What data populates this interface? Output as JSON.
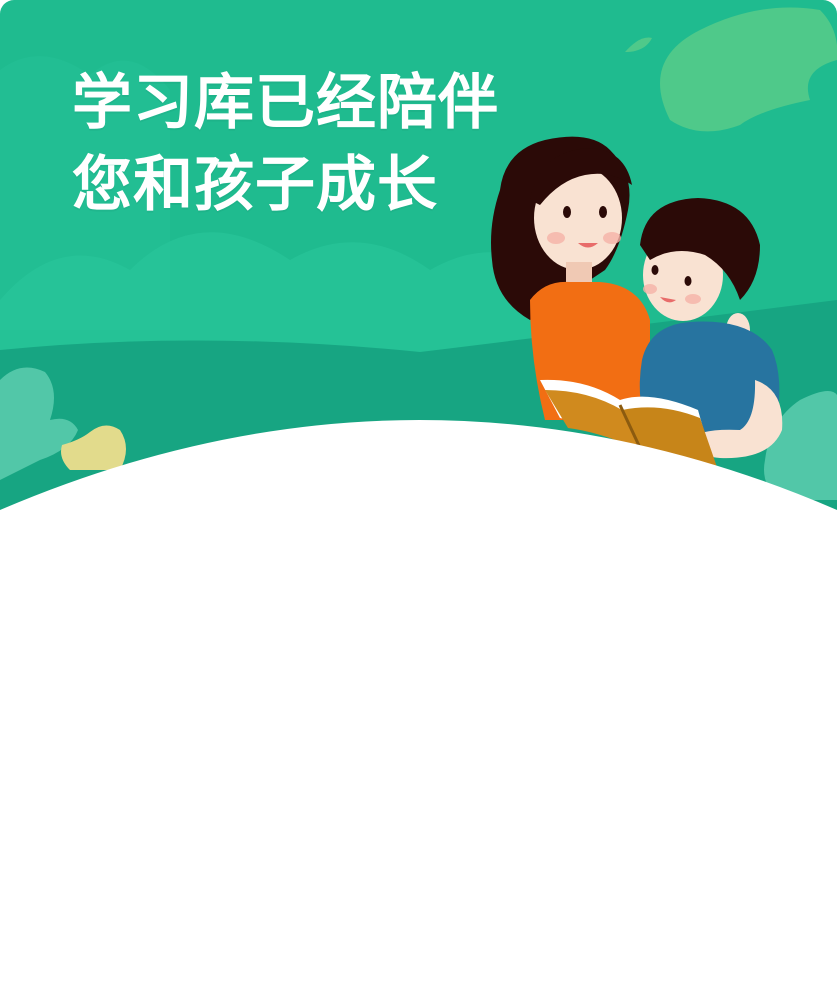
{
  "banner": {
    "headline_line1": "学习库已经陪伴",
    "headline_line2": "您和孩子成长",
    "illustration": "mother-and-child-reading-book",
    "colors": {
      "background": "#1fbb8f",
      "hills_dark": "#17a582",
      "hills_light": "#29c69b",
      "leaf_light": "#4fc98a",
      "leaf_yellow": "#e2db8c",
      "curve": "#ffffff"
    }
  }
}
